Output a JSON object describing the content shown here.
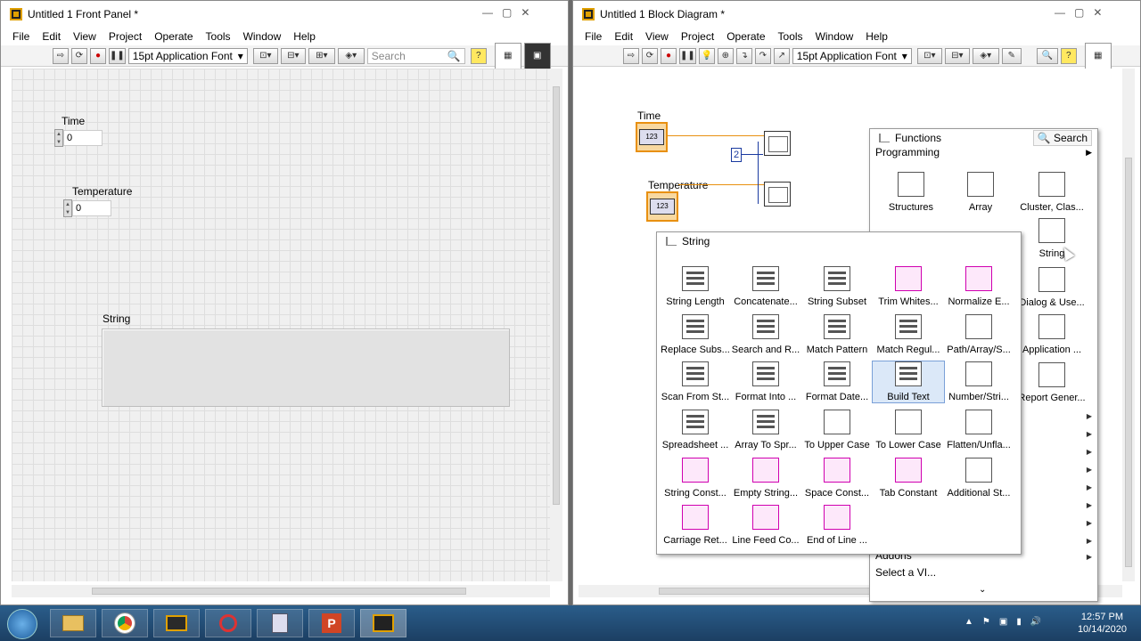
{
  "front_panel": {
    "title": "Untitled 1 Front Panel *",
    "menu": [
      "File",
      "Edit",
      "View",
      "Project",
      "Operate",
      "Tools",
      "Window",
      "Help"
    ],
    "font_select": "15pt Application Font",
    "search_placeholder": "Search",
    "controls": {
      "time_label": "Time",
      "time_value": "0",
      "temperature_label": "Temperature",
      "temperature_value": "0",
      "string_label": "String"
    }
  },
  "block_diagram": {
    "title": "Untitled 1 Block Diagram *",
    "menu": [
      "File",
      "Edit",
      "View",
      "Project",
      "Operate",
      "Tools",
      "Window",
      "Help"
    ],
    "font_select": "15pt Application Font",
    "time_label": "Time",
    "temperature_label": "Temperature",
    "constant_value": "2",
    "terminal_text": "123"
  },
  "functions_palette": {
    "title": "Functions",
    "search_label": "Search",
    "category": "Programming",
    "items": [
      "Structures",
      "Array",
      "Cluster, Clas...",
      "",
      "",
      "String",
      "",
      "",
      "Dialog & Use...",
      "",
      "",
      "Application ...",
      "",
      "",
      "Report Gener..."
    ],
    "lower_items": [
      "Addons",
      "Select a VI..."
    ]
  },
  "string_palette": {
    "title": "String",
    "items": [
      [
        "String Length",
        "Concatenate...",
        "String Subset",
        "Trim Whites...",
        "Normalize E..."
      ],
      [
        "Replace Subs...",
        "Search and R...",
        "Match Pattern",
        "Match Regul...",
        "Path/Array/S..."
      ],
      [
        "Scan From St...",
        "Format Into ...",
        "Format Date...",
        "Build Text",
        "Number/Stri..."
      ],
      [
        "Spreadsheet ...",
        "Array To Spr...",
        "To Upper Case",
        "To Lower Case",
        "Flatten/Unfla..."
      ],
      [
        "String Const...",
        "Empty String...",
        "Space Const...",
        "Tab Constant",
        "Additional St..."
      ],
      [
        "Carriage Ret...",
        "Line Feed Co...",
        "End of Line ..."
      ]
    ]
  },
  "taskbar": {
    "time": "12:57 PM",
    "date": "10/14/2020"
  }
}
